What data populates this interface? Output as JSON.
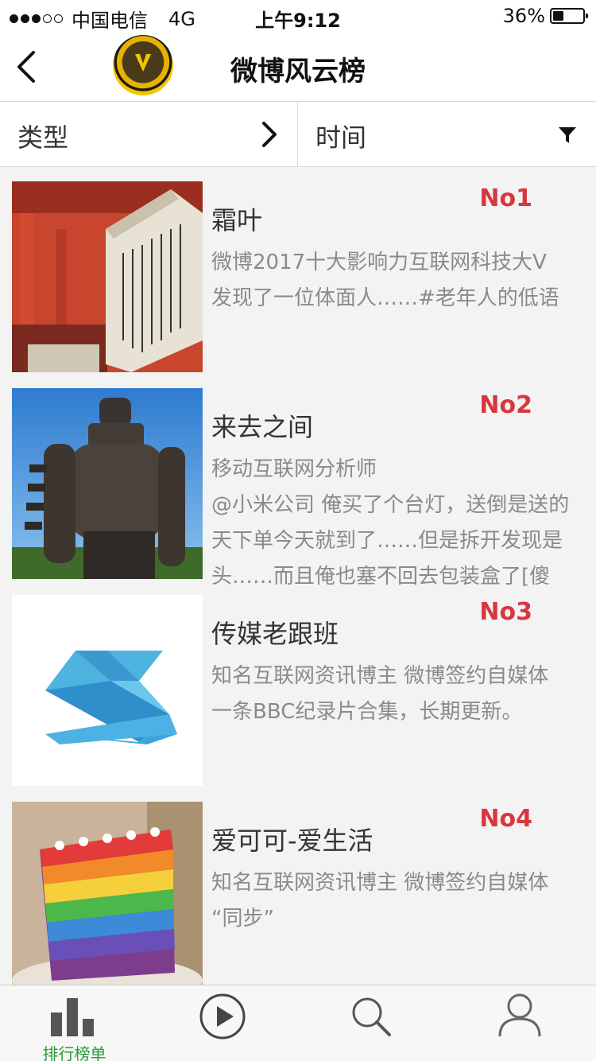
{
  "status_bar": {
    "carrier": "中国电信",
    "network": "4G",
    "time": "上午9:12",
    "battery": "36%",
    "battery_level": 0.36
  },
  "nav": {
    "title": "微博风云榜"
  },
  "filters": {
    "type_label": "类型",
    "time_label": "时间"
  },
  "items": [
    {
      "rank": "No1",
      "name": "霜叶",
      "lines": [
        "微博2017十大影响力互联网科技大V",
        "发现了一位体面人……#老年人的低语"
      ],
      "thumb": "shrine-photo"
    },
    {
      "rank": "No2",
      "name": "来去之间",
      "lines": [
        "移动互联网分析师",
        "@小米公司 俺买了个台灯，送倒是送的",
        "天下单今天就到了……但是拆开发现是",
        "头……而且俺也塞不回去包装盒了[傻"
      ],
      "thumb": "robot-statue-photo"
    },
    {
      "rank": "No3",
      "name": "传媒老跟班",
      "lines": [
        "知名互联网资讯博主 微博签约自媒体",
        "一条BBC纪录片合集，长期更新。"
      ],
      "thumb": "s-logo"
    },
    {
      "rank": "No4",
      "name": "爱可可-爱生活",
      "lines": [
        "知名互联网资讯博主 微博签约自媒体",
        "“同步”"
      ],
      "thumb": "rainbow-cake-photo"
    }
  ],
  "tabs": [
    {
      "label": "排行榜单",
      "icon": "bar-chart-icon",
      "active": true
    },
    {
      "label": "",
      "icon": "play-icon",
      "active": false
    },
    {
      "label": "",
      "icon": "search-icon",
      "active": false
    },
    {
      "label": "",
      "icon": "user-icon",
      "active": false
    }
  ],
  "colors": {
    "rank_red": "#d9363e",
    "active_tab_green": "#2a9a3a"
  }
}
